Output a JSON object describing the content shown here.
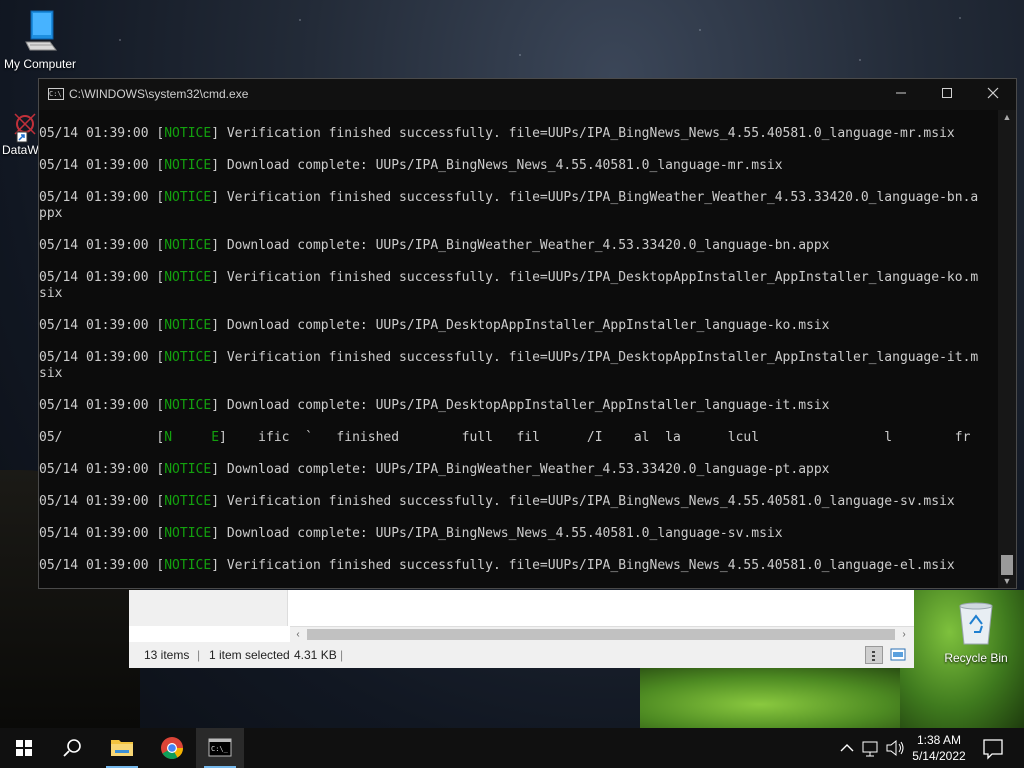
{
  "desktop": {
    "icons": [
      {
        "label": "My Computer"
      },
      {
        "label": "DataW"
      },
      {
        "label": "Recycle Bin"
      }
    ]
  },
  "cmd_window": {
    "title": "C:\\WINDOWS\\system32\\cmd.exe",
    "lines": [
      {
        "pre": "05/14 01:39:00 [",
        "tag": "NOTICE",
        "post": "] Verification finished successfully. file=UUPs/IPA_BingNews_News_4.55.40581.0_language-mr.msix",
        "cont": ""
      },
      {
        "pre": "05/14 01:39:00 [",
        "tag": "NOTICE",
        "post": "] Download complete: UUPs/IPA_BingNews_News_4.55.40581.0_language-mr.msix",
        "cont": ""
      },
      {
        "pre": "05/14 01:39:00 [",
        "tag": "NOTICE",
        "post": "] Verification finished successfully. file=UUPs/IPA_BingWeather_Weather_4.53.33420.0_language-bn.a",
        "cont": "ppx"
      },
      {
        "pre": "05/14 01:39:00 [",
        "tag": "NOTICE",
        "post": "] Download complete: UUPs/IPA_BingWeather_Weather_4.53.33420.0_language-bn.appx",
        "cont": ""
      },
      {
        "pre": "05/14 01:39:00 [",
        "tag": "NOTICE",
        "post": "] Verification finished successfully. file=UUPs/IPA_DesktopAppInstaller_AppInstaller_language-ko.m",
        "cont": "six"
      },
      {
        "pre": "05/14 01:39:00 [",
        "tag": "NOTICE",
        "post": "] Download complete: UUPs/IPA_DesktopAppInstaller_AppInstaller_language-ko.msix",
        "cont": ""
      },
      {
        "pre": "05/14 01:39:00 [",
        "tag": "NOTICE",
        "post": "] Verification finished successfully. file=UUPs/IPA_DesktopAppInstaller_AppInstaller_language-it.m",
        "cont": "six"
      },
      {
        "pre": "05/14 01:39:00 [",
        "tag": "NOTICE",
        "post": "] Download complete: UUPs/IPA_DesktopAppInstaller_AppInstaller_language-it.msix",
        "cont": ""
      },
      {
        "pre": "05/            [",
        "tag": "N     E",
        "post": "]    ific  `   finished        full   fil      /I    al  la      lcul                l        fr",
        "cont": ""
      },
      {
        "pre": "05/14 01:39:00 [",
        "tag": "NOTICE",
        "post": "] Download complete: UUPs/IPA_BingWeather_Weather_4.53.33420.0_language-pt.appx",
        "cont": ""
      },
      {
        "pre": "05/14 01:39:00 [",
        "tag": "NOTICE",
        "post": "] Verification finished successfully. file=UUPs/IPA_BingNews_News_4.55.40581.0_language-sv.msix",
        "cont": ""
      },
      {
        "pre": "05/14 01:39:00 [",
        "tag": "NOTICE",
        "post": "] Download complete: UUPs/IPA_BingNews_News_4.55.40581.0_language-sv.msix",
        "cont": ""
      },
      {
        "pre": "05/14 01:39:00 [",
        "tag": "NOTICE",
        "post": "] Verification finished successfully. file=UUPs/IPA_BingNews_News_4.55.40581.0_language-el.msix",
        "cont": ""
      }
    ]
  },
  "explorer": {
    "status": {
      "items": "13 items",
      "selected": "1 item selected",
      "size": "4.31 KB"
    }
  },
  "taskbar": {
    "clock_time": "1:38 AM",
    "clock_date": "5/14/2022"
  },
  "colors": {
    "notice": "#13a10e",
    "console_text": "#cccccc",
    "console_bg": "#0c0c0c",
    "taskbar_bg": "#101010"
  }
}
